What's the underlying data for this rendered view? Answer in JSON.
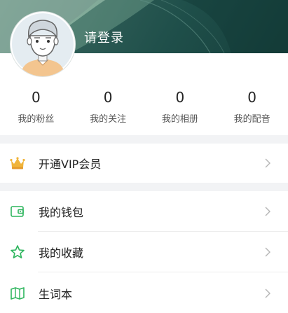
{
  "profile": {
    "login_label": "请登录"
  },
  "stats": [
    {
      "value": "0",
      "label": "我的粉丝"
    },
    {
      "value": "0",
      "label": "我的关注"
    },
    {
      "value": "0",
      "label": "我的相册"
    },
    {
      "value": "0",
      "label": "我的配音"
    }
  ],
  "menu": {
    "vip": {
      "label": "开通VIP会员",
      "icon": "crown-icon"
    },
    "wallet": {
      "label": "我的钱包",
      "icon": "wallet-icon"
    },
    "favorites": {
      "label": "我的收藏",
      "icon": "star-icon"
    },
    "vocabulary": {
      "label": "生词本",
      "icon": "book-icon"
    }
  },
  "colors": {
    "header_dark": "#1f4f4a",
    "accent_green": "#2db55d",
    "crown_gold": "#f0b43a"
  }
}
